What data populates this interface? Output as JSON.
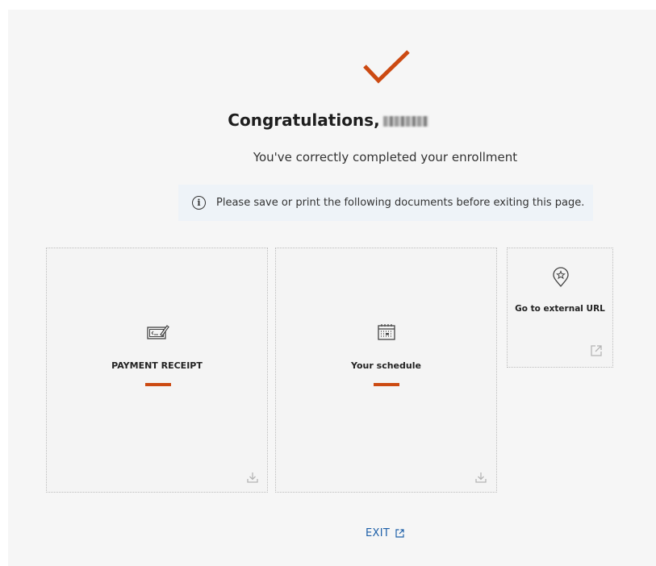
{
  "colors": {
    "accent": "#cc4a12",
    "link": "#1d5fa8",
    "notice_bg": "#eef3f8",
    "panel_bg": "#f6f6f6"
  },
  "header": {
    "check_icon": "checkmark-icon",
    "title": "Congratulations,",
    "subtitle": "You've correctly completed your enrollment"
  },
  "notice": {
    "icon": "info-icon",
    "text": "Please save or print the following documents before exiting this page."
  },
  "cards": [
    {
      "label": "PAYMENT RECEIPT",
      "icon": "receipt-icon",
      "corner_icon": "download-icon"
    },
    {
      "label": "Your schedule",
      "icon": "calendar-icon",
      "corner_icon": "download-icon"
    },
    {
      "label": "Go to external URL",
      "icon": "location-pin-star-icon",
      "corner_icon": "external-link-icon"
    }
  ],
  "exit": {
    "label": "EXIT",
    "icon": "external-link-icon"
  }
}
